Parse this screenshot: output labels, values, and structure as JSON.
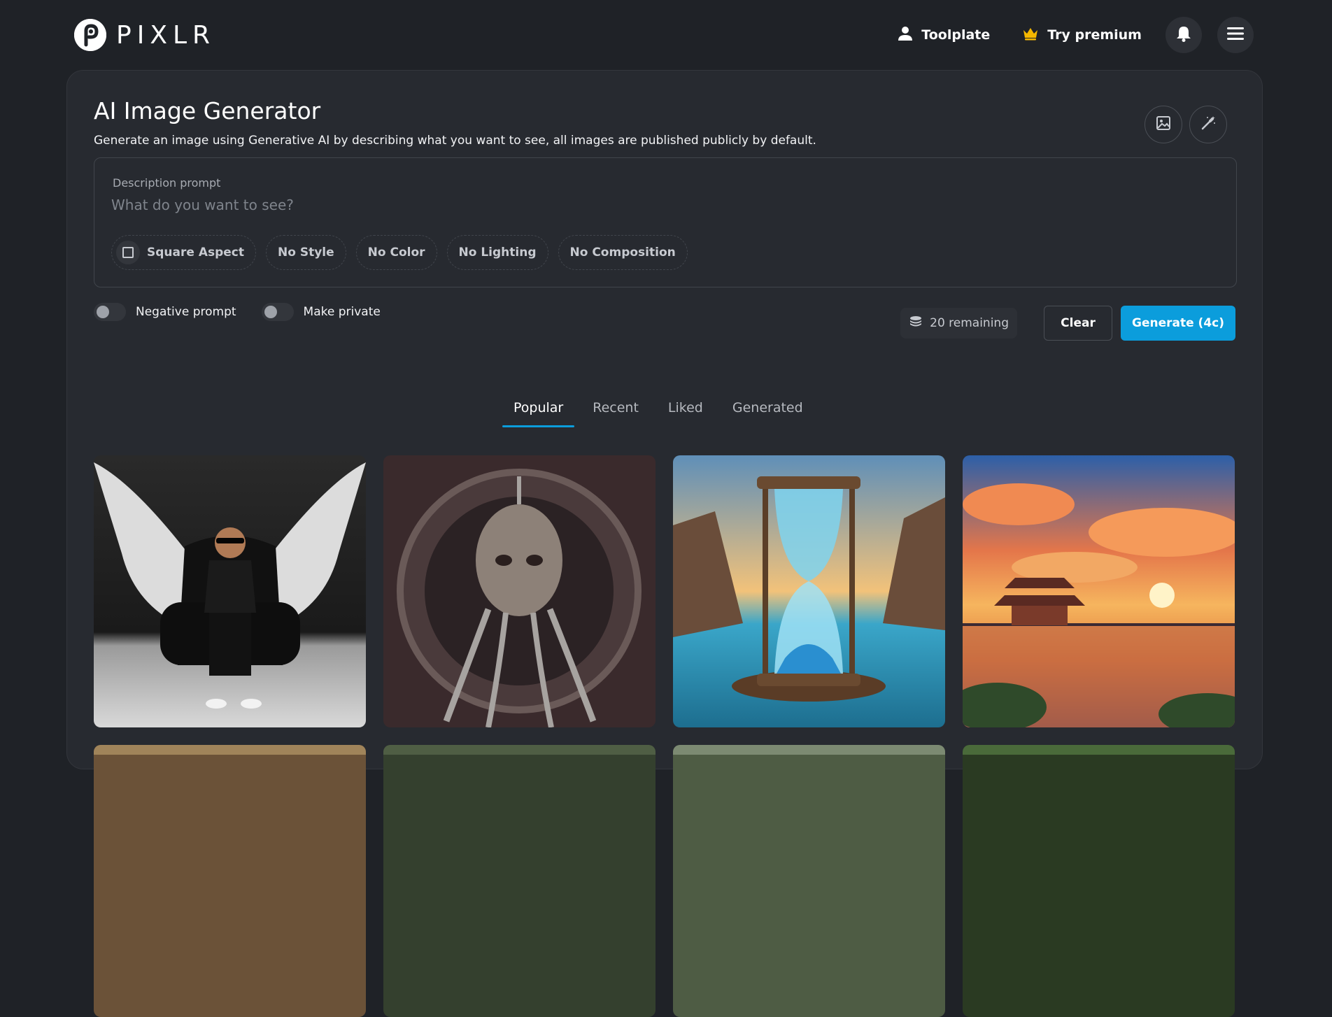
{
  "brand": {
    "name": "PIXLR"
  },
  "header": {
    "account_label": "Toolplate",
    "premium_label": "Try premium"
  },
  "main": {
    "title": "AI Image Generator",
    "subtitle": "Generate an image using Generative AI by describing what you want to see, all images are published publicly by default.",
    "prompt": {
      "label": "Description prompt",
      "placeholder": "What do you want to see?",
      "value": ""
    },
    "chips": [
      "Square Aspect",
      "No Style",
      "No Color",
      "No Lighting",
      "No Composition"
    ],
    "toggles": {
      "negative_prompt": "Negative prompt",
      "make_private": "Make private"
    },
    "remaining": "20 remaining",
    "clear_label": "Clear",
    "generate_label": "Generate (4c)",
    "tabs": [
      "Popular",
      "Recent",
      "Liked",
      "Generated"
    ],
    "active_tab": "Popular"
  },
  "colors": {
    "background": "#1f2227",
    "card": "#272a30",
    "accent": "#0b9ddc",
    "premium_crown": "#f5b800"
  },
  "icons": {
    "account": "user-icon",
    "premium": "crown-icon",
    "notifications": "bell-icon",
    "menu": "hamburger-icon",
    "image_tool": "image-icon",
    "wand_tool": "magic-wand-icon",
    "credits": "coins-stack-icon"
  }
}
